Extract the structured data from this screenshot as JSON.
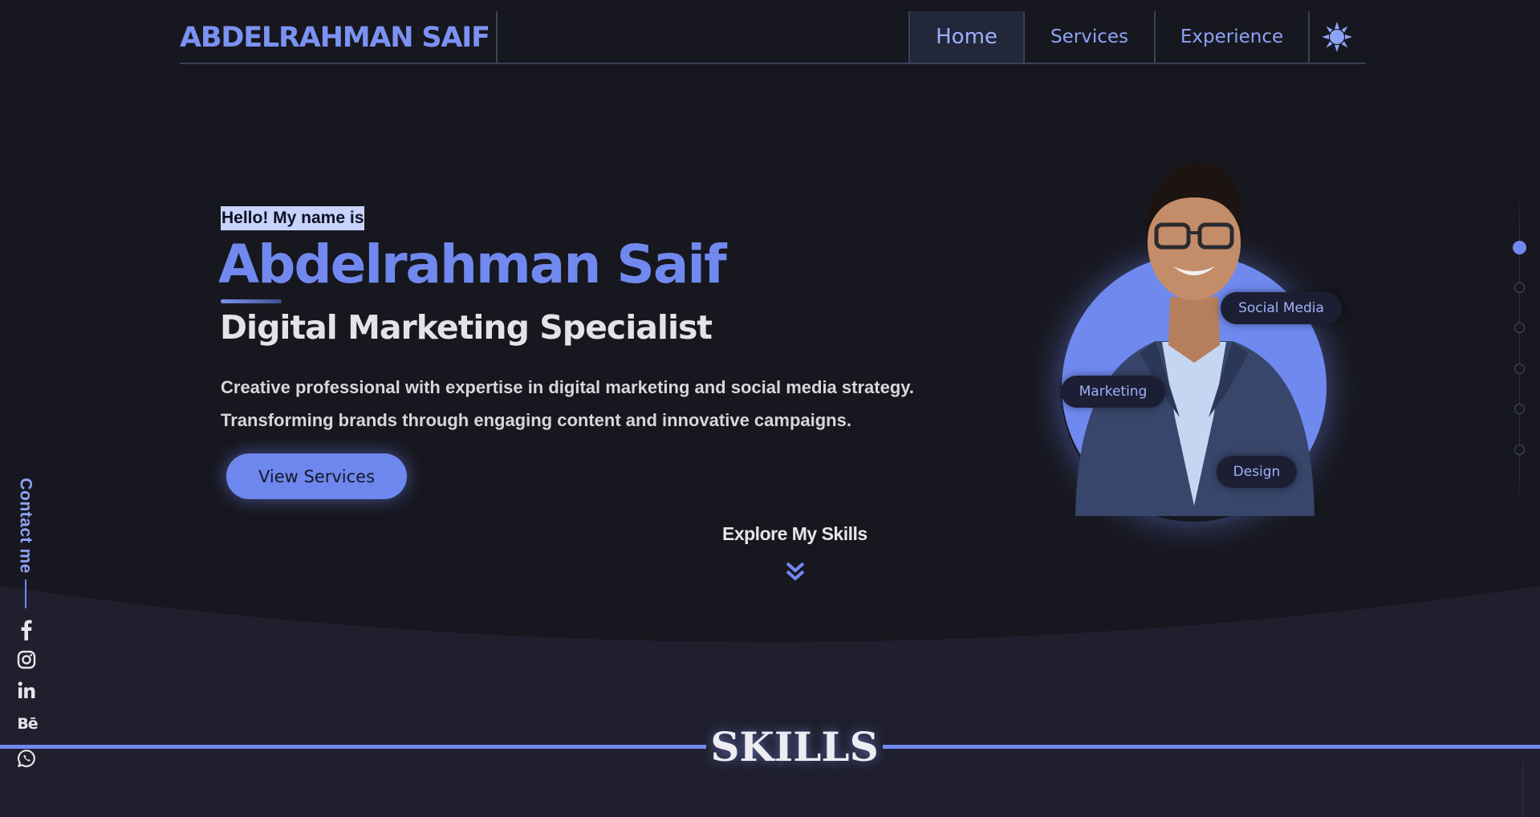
{
  "header": {
    "brand": "ABDELRAHMAN SAIF",
    "nav": [
      {
        "label": "Home",
        "active": true
      },
      {
        "label": "Services"
      },
      {
        "label": "Experience"
      }
    ],
    "theme_toggle_icon": "sun-icon"
  },
  "hero": {
    "greeting": "Hello! My name is",
    "name": "Abdelrahman Saif",
    "role": "Digital Marketing Specialist",
    "description_line1": "Creative professional with expertise in digital marketing and social media strategy.",
    "description_line2": "Transforming brands through engaging content and innovative campaigns.",
    "cta_label": "View Services"
  },
  "portrait": {
    "chips": [
      "Social Media",
      "Marketing",
      "Design"
    ]
  },
  "explore": {
    "label": "Explore My Skills",
    "icon": "double-chevron-down-icon"
  },
  "scroll_indicator": {
    "total": 6,
    "active_index": 0
  },
  "contact": {
    "label": "Contact me",
    "socials": [
      "facebook-icon",
      "instagram-icon",
      "linkedin-icon",
      "behance-icon",
      "whatsapp-icon"
    ],
    "behance_text": "Bē"
  },
  "skills_section": {
    "title": "SKILLS"
  },
  "colors": {
    "background": "#17171f",
    "section_background": "#1f1f2e",
    "accent": "#7189ee",
    "nav_text": "#8ea3f6"
  }
}
